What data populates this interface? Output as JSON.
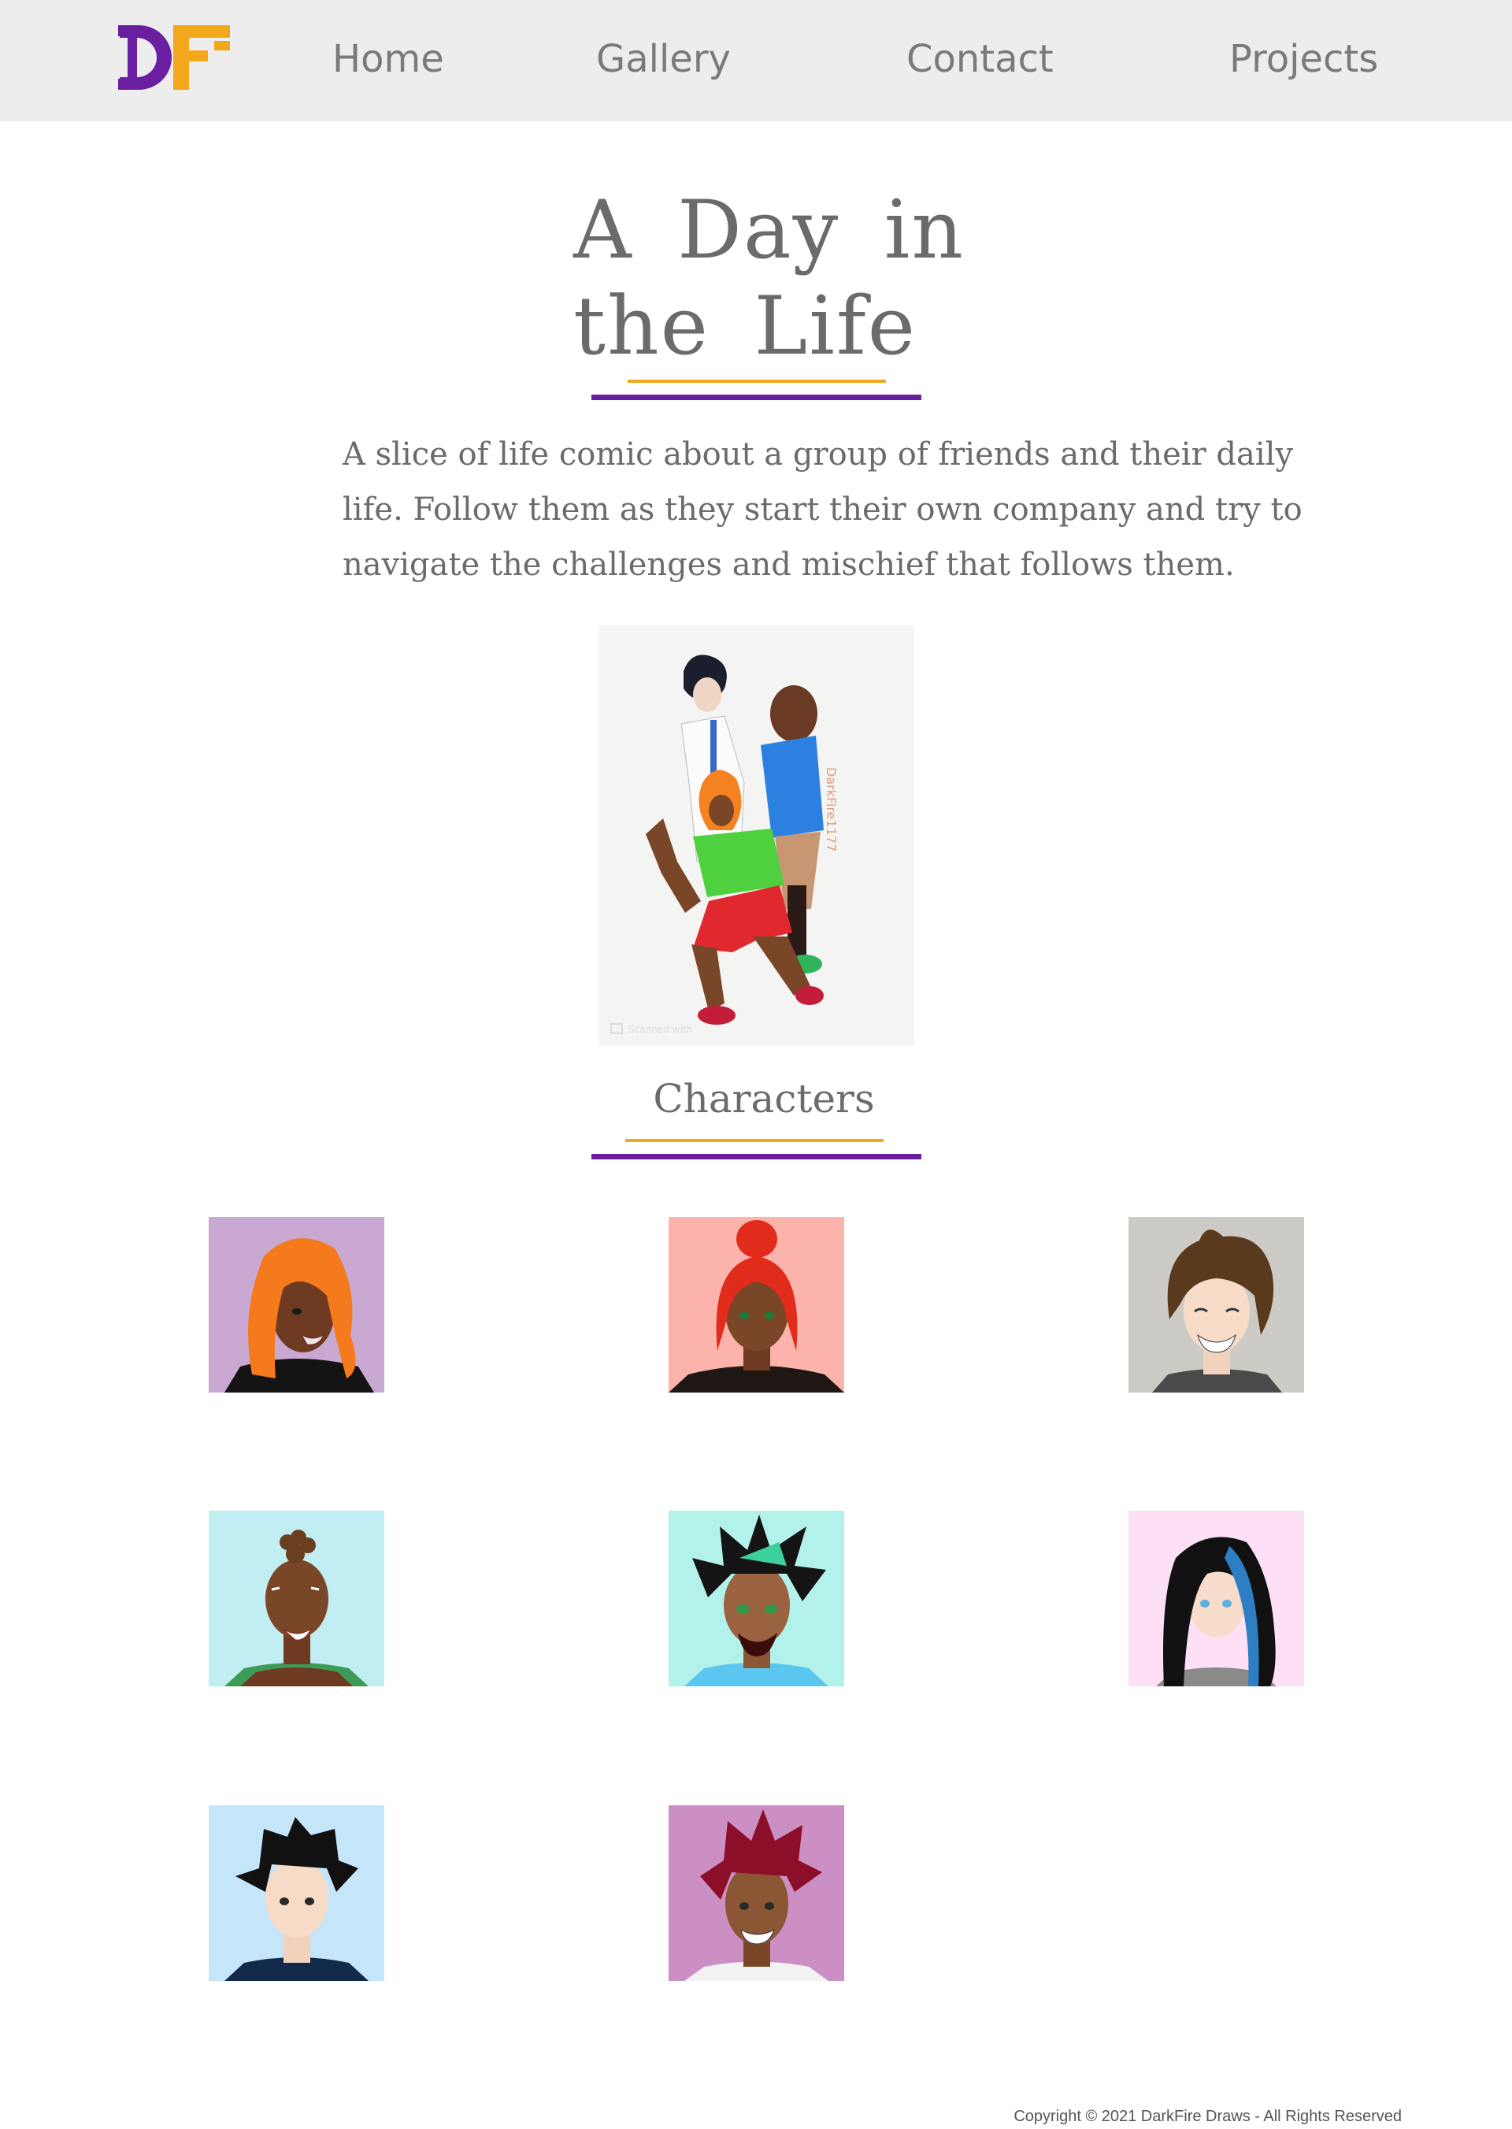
{
  "brand": {
    "logo_text": "DF",
    "primary_color": "#6a1fa0",
    "accent_color": "#f3a81c"
  },
  "nav": {
    "items": [
      {
        "label": "Home"
      },
      {
        "label": "Gallery"
      },
      {
        "label": "Contact"
      },
      {
        "label": "Projects"
      }
    ]
  },
  "page": {
    "title": "A Day in the Life",
    "description": "A slice of life comic about a group of friends and their daily life. Follow them as they start their own company and try to navigate the challenges and mischief that follows them.",
    "cover_signature": "DarkFire1177",
    "cover_scan_mark": "Scanned with"
  },
  "characters": {
    "heading": "Characters",
    "items": [
      {
        "background": "#c9a8d1",
        "hair": "orange",
        "skin": "dark brown",
        "shirt": "black"
      },
      {
        "background": "#fbb3ab",
        "hair": "red",
        "skin": "brown",
        "shirt": "black"
      },
      {
        "background": "#cdcbc5",
        "hair": "brown",
        "skin": "light",
        "shirt": "grey"
      },
      {
        "background": "#c0eef2",
        "hair": "brown",
        "skin": "dark brown",
        "shirt": "green"
      },
      {
        "background": "#b3f2ea",
        "hair": "black",
        "skin": "brown",
        "shirt": "blue"
      },
      {
        "background": "#fde0f5",
        "hair": "black and blue",
        "skin": "light",
        "shirt": "grey"
      },
      {
        "background": "#c4e6f8",
        "hair": "black",
        "skin": "light",
        "shirt": "navy"
      },
      {
        "background": "#cc8fc4",
        "hair": "crimson",
        "skin": "brown",
        "shirt": "white"
      }
    ]
  },
  "footer": {
    "text": "Copyright © 2021 DarkFire Draws - All Rights Reserved"
  }
}
